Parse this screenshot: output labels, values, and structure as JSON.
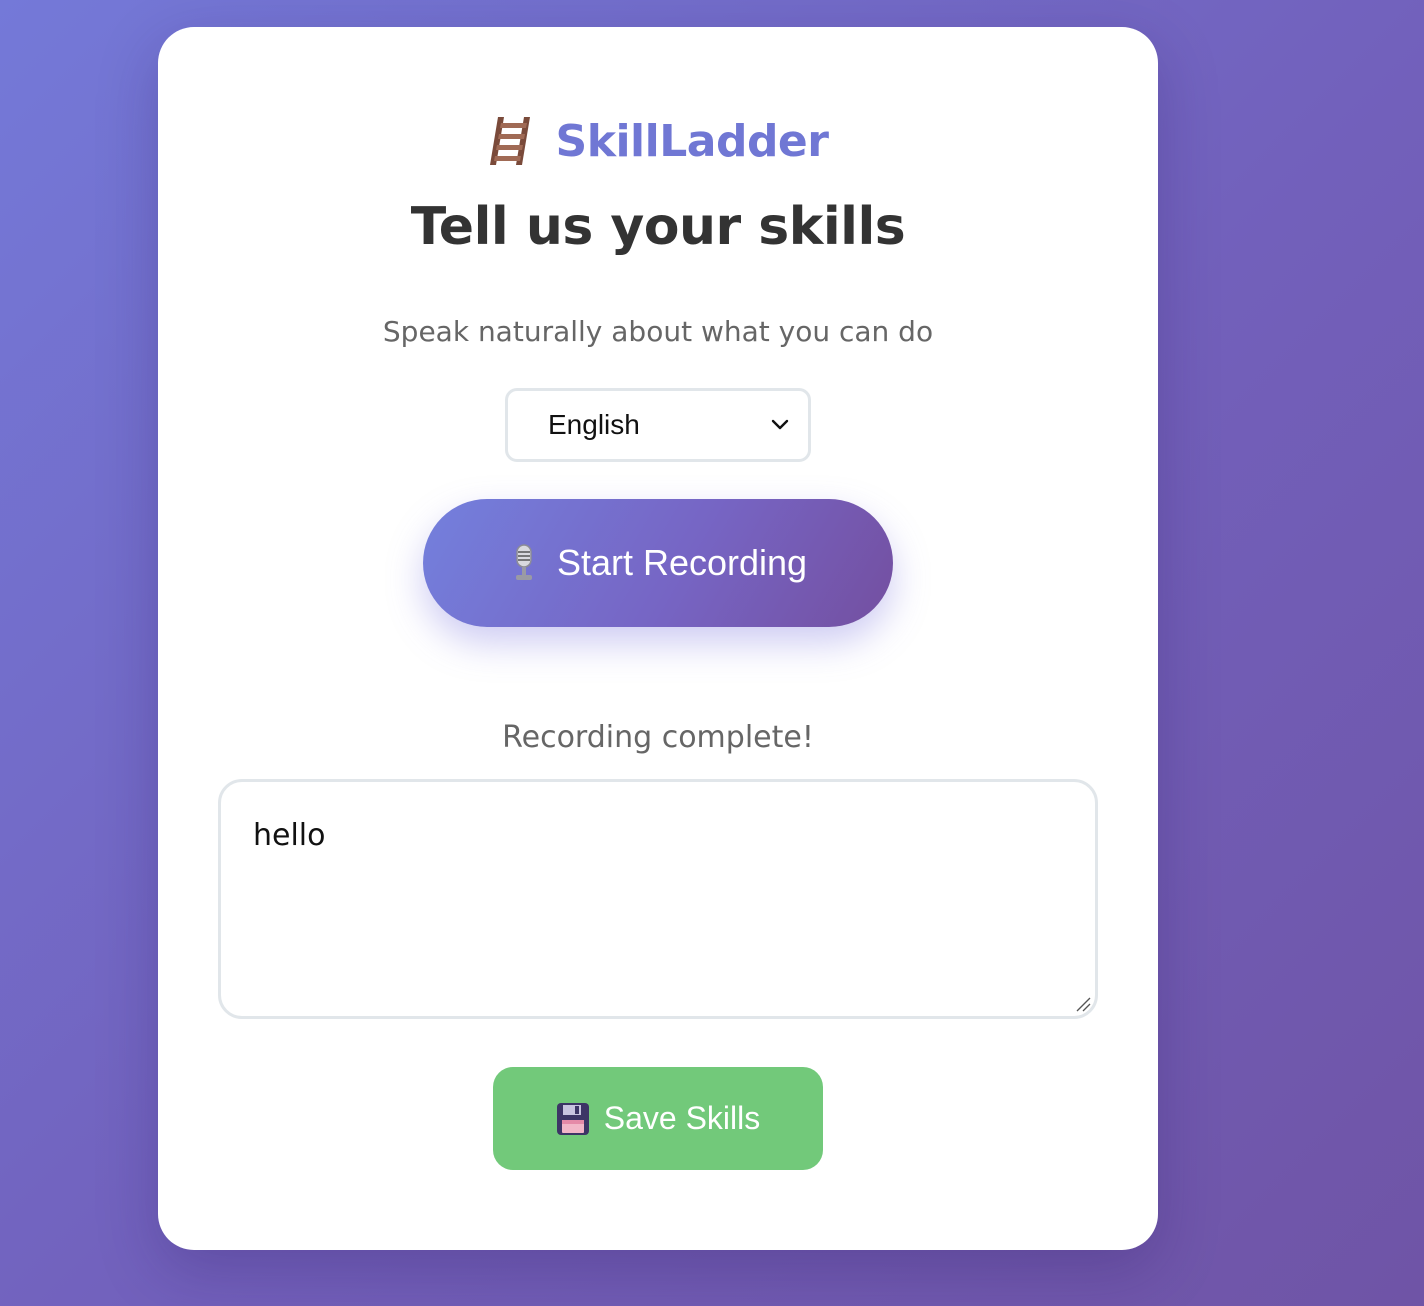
{
  "brand": {
    "name": "SkillLadder",
    "icon": "ladder-icon",
    "color": "#7077d4"
  },
  "page": {
    "title": "Tell us your skills",
    "subtitle": "Speak naturally about what you can do"
  },
  "language_select": {
    "selected": "English"
  },
  "record_button": {
    "label": "Start Recording",
    "icon": "microphone-icon"
  },
  "status": {
    "text": "Recording complete!"
  },
  "skills_input": {
    "value": "hello"
  },
  "save_button": {
    "label": "Save Skills",
    "icon": "floppy-disk-icon",
    "color": "#72c97a"
  }
}
